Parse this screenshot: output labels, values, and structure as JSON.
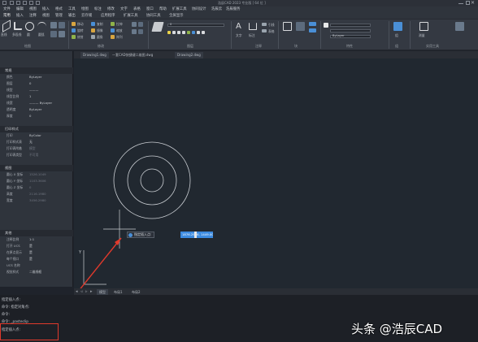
{
  "titlebar": {
    "title": "浩辰CAD 2023 专业版 [ 64 位 ]"
  },
  "menus": {
    "row1": [
      "文件",
      "编辑",
      "视图",
      "插入",
      "格式",
      "工具",
      "绘图",
      "标注",
      "修改",
      "文字",
      "表格",
      "窗口",
      "帮助",
      "扩展工具",
      "协同设计",
      "浩辰云",
      "浩辰服务"
    ],
    "row2": [
      "常用",
      "插入",
      "注释",
      "视图",
      "管理",
      "输出",
      "云存储",
      "应用程序",
      "扩展工具",
      "协同工具",
      "全屏显示"
    ]
  },
  "ribbon": {
    "draw_tools": [
      "直线",
      "多段线",
      "圆",
      "圆弧"
    ],
    "modify_tools": [
      "移动",
      "旋转",
      "修剪",
      "复制",
      "镜像",
      "圆角",
      "拉伸",
      "缩放",
      "阵列"
    ],
    "annotation_tools": [
      "文字",
      "标注",
      "引线",
      "表格"
    ],
    "layer_name": "0",
    "bylayer": "ByLayer",
    "utility": [
      "组",
      "测量",
      "实用工具"
    ],
    "panels": [
      "绘图",
      "修改",
      "图层",
      "注释",
      "块",
      "特性",
      "组",
      "实用工具"
    ]
  },
  "doc_tabs": [
    "Drawing1.dwg",
    "一套CAD快捷键二维图.dwg",
    "Drawing2.dwg"
  ],
  "properties": {
    "general_header": "常规",
    "general": [
      {
        "k": "颜色",
        "v": "ByLayer"
      },
      {
        "k": "图层",
        "v": "0"
      },
      {
        "k": "线型",
        "v": "———"
      },
      {
        "k": "线型比例",
        "v": "1"
      },
      {
        "k": "线宽",
        "v": "——— ByLayer"
      },
      {
        "k": "透明度",
        "v": "ByLayer"
      },
      {
        "k": "厚度",
        "v": "0"
      }
    ],
    "print_header": "打印样式",
    "print": [
      {
        "k": "打印",
        "v": "ByColor"
      },
      {
        "k": "打印样式表",
        "v": "无"
      },
      {
        "k": "打印表附着",
        "v": "模型"
      },
      {
        "k": "打印表类型",
        "v": "不可用"
      }
    ],
    "view_header": "视图",
    "view": [
      {
        "k": "圆心 X 坐标",
        "v": "1526.1049"
      },
      {
        "k": "圆心 Y 坐标",
        "v": "1103.3606"
      },
      {
        "k": "圆心 Z 坐标",
        "v": "0"
      },
      {
        "k": "高度",
        "v": "2116.1980"
      },
      {
        "k": "宽度",
        "v": "3456.2980"
      }
    ],
    "misc_header": "其他",
    "misc": [
      {
        "k": "注释比例",
        "v": "1:1"
      },
      {
        "k": "打开 UCS",
        "v": "是"
      },
      {
        "k": "在原点显示",
        "v": "是"
      },
      {
        "k": "每个视口",
        "v": "是"
      },
      {
        "k": "UCS 名称",
        "v": ""
      },
      {
        "k": "视觉样式",
        "v": "二维线框"
      }
    ]
  },
  "canvas": {
    "prompt": "指定插入点:",
    "coord_input": "1876.2936, 1449.0049"
  },
  "layout_tabs": [
    "模型",
    "布局1",
    "布局2"
  ],
  "command_line": [
    "指定插入点:",
    "命令: 指定对角点:",
    "命令:",
    "命令: _pasteclip",
    "指定插入点:"
  ],
  "watermark": "头条 @浩辰CAD",
  "colors": {
    "canvas": "#212830",
    "accent": "#3c8be0",
    "annotation": "#e03a2c"
  }
}
